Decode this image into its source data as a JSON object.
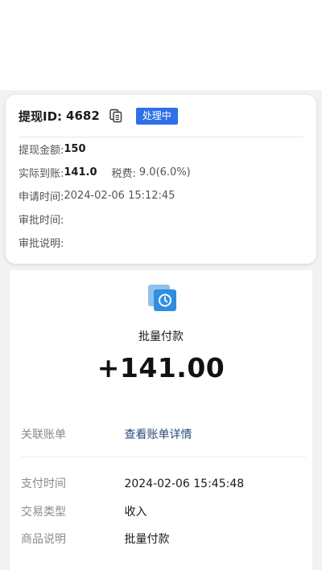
{
  "withdrawal": {
    "id_label": "提现ID:",
    "id_value": "4682",
    "status": "处理中",
    "rows": {
      "amount_label": "提现金额:",
      "amount_value": "150",
      "actual_label": "实际到账:",
      "actual_value": "141.0",
      "tax_label": "税费:",
      "tax_value": "9.0(6.0%)",
      "apply_time_label": "申请时间:",
      "apply_time_value": "2024-02-06 15:12:45",
      "review_time_label": "审批时间:",
      "review_note_label": "审批说明:"
    }
  },
  "bill": {
    "icon": "batch-payment-icon",
    "name": "批量付款",
    "amount": "+141.00",
    "related_label": "关联账单",
    "related_link": "查看账单详情",
    "pay_time_label": "支付时间",
    "pay_time_value": "2024-02-06 15:45:48",
    "type_label": "交易类型",
    "type_value": "收入",
    "desc_label": "商品说明",
    "desc_value": "批量付款"
  },
  "colors": {
    "badge": "#2f6fe8",
    "link": "#2a4a7a",
    "icon": "#2f8ee0"
  }
}
